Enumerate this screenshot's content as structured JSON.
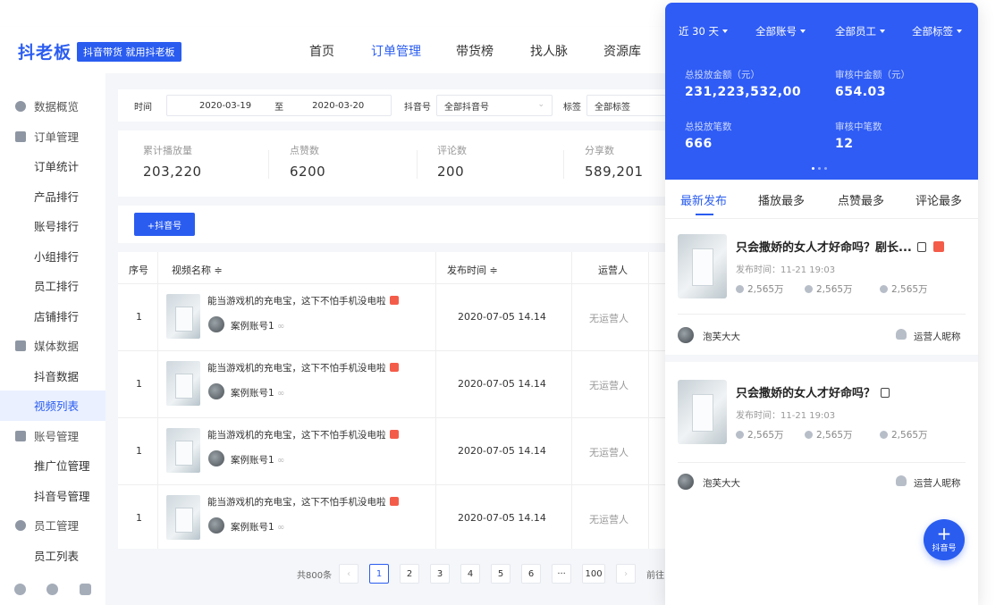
{
  "logo": {
    "text": "抖老板",
    "badge": "抖音带货 就用抖老板"
  },
  "nav": [
    "首页",
    "订单管理",
    "带货榜",
    "找人脉",
    "资源库"
  ],
  "sidebar": {
    "items": [
      {
        "label": "数据概览",
        "group": true
      },
      {
        "label": "订单管理",
        "group": true
      },
      {
        "label": "订单统计"
      },
      {
        "label": "产品排行"
      },
      {
        "label": "账号排行"
      },
      {
        "label": "小组排行"
      },
      {
        "label": "员工排行"
      },
      {
        "label": "店铺排行"
      },
      {
        "label": "媒体数据",
        "group": true
      },
      {
        "label": "抖音数据"
      },
      {
        "label": "视频列表",
        "active": true
      },
      {
        "label": "账号管理",
        "group": true
      },
      {
        "label": "推广位管理"
      },
      {
        "label": "抖音号管理"
      },
      {
        "label": "员工管理",
        "group": true
      },
      {
        "label": "员工列表"
      }
    ]
  },
  "filter": {
    "time_label": "时间",
    "date_from": "2020-03-19",
    "to": "至",
    "date_to": "2020-03-20",
    "account_label": "抖音号",
    "account_value": "全部抖音号",
    "tag_label": "标签",
    "tag_value": "全部标签"
  },
  "stats": [
    {
      "label": "累计播放量",
      "value": "203,220"
    },
    {
      "label": "点赞数",
      "value": "6200"
    },
    {
      "label": "评论数",
      "value": "200"
    },
    {
      "label": "分享数",
      "value": "589,201"
    }
  ],
  "add_button": "+抖音号",
  "table": {
    "headers": {
      "index": "序号",
      "name": "视频名称 ≑",
      "time": "发布时间 ≑",
      "operator": "运营人"
    },
    "rows": [
      {
        "index": "1",
        "title": "能当游戏机的充电宝，这下不怕手机没电啦",
        "account": "案例账号1",
        "time": "2020-07-05  14.14",
        "operator": "无运营人"
      },
      {
        "index": "1",
        "title": "能当游戏机的充电宝，这下不怕手机没电啦",
        "account": "案例账号1",
        "time": "2020-07-05  14.14",
        "operator": "无运营人"
      },
      {
        "index": "1",
        "title": "能当游戏机的充电宝，这下不怕手机没电啦",
        "account": "案例账号1",
        "time": "2020-07-05  14.14",
        "operator": "无运营人"
      },
      {
        "index": "1",
        "title": "能当游戏机的充电宝，这下不怕手机没电啦",
        "account": "案例账号1",
        "time": "2020-07-05  14.14",
        "operator": "无运营人"
      }
    ]
  },
  "pager": {
    "total": "共800条",
    "prev": "‹",
    "pages": [
      "1",
      "2",
      "3",
      "4",
      "5",
      "6",
      "···",
      "100"
    ],
    "next": "›",
    "goto": "前往"
  },
  "panel": {
    "dropdowns": [
      "近 30 天",
      "全部账号",
      "全部员工",
      "全部标签"
    ],
    "metrics": [
      {
        "label": "总投放金额（元）",
        "value": "231,223,532,00"
      },
      {
        "label": "审核中金额（元）",
        "value": "654.03"
      },
      {
        "label": "总投放笔数",
        "value": "666"
      },
      {
        "label": "审核中笔数",
        "value": "12"
      }
    ],
    "tabs": [
      "最新发布",
      "播放最多",
      "点赞最多",
      "评论最多"
    ],
    "cards": [
      {
        "title": "只会撒娇的女人才好命吗？剧长...",
        "time": "发布时间：11-21 19:03",
        "plays": "2,565万",
        "likes": "2,565万",
        "comments": "2,565万",
        "user": "泡芙大大",
        "operator": "运营人昵称"
      },
      {
        "title": "只会撒娇的女人才好命吗？",
        "time": "发布时间：11-21 19:03",
        "plays": "2,565万",
        "likes": "2,565万",
        "comments": "2,565万",
        "user": "泡芙大大",
        "operator": "运营人昵称"
      }
    ],
    "fab": {
      "plus": "+",
      "label": "抖音号"
    }
  },
  "colors": {
    "brand": "#2a5cf0",
    "panel_header": "#2f5cf5"
  }
}
